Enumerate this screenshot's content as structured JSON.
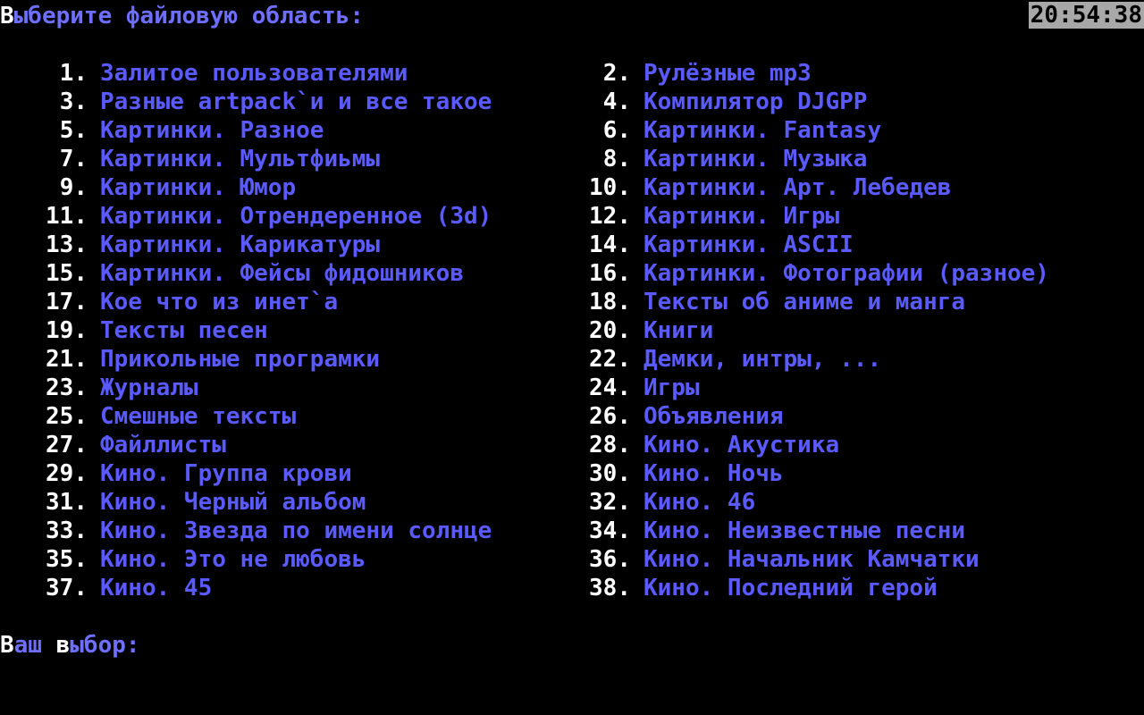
{
  "header": {
    "prompt_first_letter": "В",
    "prompt_rest": "ыберите файловую область:",
    "clock": "20:54:38"
  },
  "menu": {
    "left": [
      {
        "num": "1.",
        "label": "Залитое пользователями"
      },
      {
        "num": "3.",
        "label": "Разные artpack`и и все такое"
      },
      {
        "num": "5.",
        "label": "Картинки. Разное"
      },
      {
        "num": "7.",
        "label": "Картинки. Мультфиьмы"
      },
      {
        "num": "9.",
        "label": "Картинки. Юмор"
      },
      {
        "num": "11.",
        "label": "Картинки. Отрендеренное (3d)"
      },
      {
        "num": "13.",
        "label": "Картинки. Карикатуры"
      },
      {
        "num": "15.",
        "label": "Картинки. Фейсы фидошников"
      },
      {
        "num": "17.",
        "label": "Кое что из инет`а"
      },
      {
        "num": "19.",
        "label": "Тексты песен"
      },
      {
        "num": "21.",
        "label": "Прикольные програмки"
      },
      {
        "num": "23.",
        "label": "Журналы"
      },
      {
        "num": "25.",
        "label": "Смешные тексты"
      },
      {
        "num": "27.",
        "label": "Файллисты"
      },
      {
        "num": "29.",
        "label": "Кино. Группа крови"
      },
      {
        "num": "31.",
        "label": "Кино. Черный альбом"
      },
      {
        "num": "33.",
        "label": "Кино. Звезда по имени солнце"
      },
      {
        "num": "35.",
        "label": "Кино. Это не любовь"
      },
      {
        "num": "37.",
        "label": "Кино. 45"
      }
    ],
    "right": [
      {
        "num": "2.",
        "label": "Рулёзные mp3"
      },
      {
        "num": "4.",
        "label": "Компилятор DJGPP"
      },
      {
        "num": "6.",
        "label": "Картинки. Fantasy"
      },
      {
        "num": "8.",
        "label": "Картинки. Музыка"
      },
      {
        "num": "10.",
        "label": "Картинки. Арт. Лебедев"
      },
      {
        "num": "12.",
        "label": "Картинки. Игры"
      },
      {
        "num": "14.",
        "label": "Картинки. ASCII"
      },
      {
        "num": "16.",
        "label": "Картинки. Фотографии (разное)"
      },
      {
        "num": "18.",
        "label": "Тексты об аниме и манга"
      },
      {
        "num": "20.",
        "label": "Книги"
      },
      {
        "num": "22.",
        "label": "Демки, интры, ..."
      },
      {
        "num": "24.",
        "label": "Игры"
      },
      {
        "num": "26.",
        "label": "Объявления"
      },
      {
        "num": "28.",
        "label": "Кино. Акустика"
      },
      {
        "num": "30.",
        "label": "Кино. Ночь"
      },
      {
        "num": "32.",
        "label": "Кино. 46"
      },
      {
        "num": "34.",
        "label": "Кино. Неизвестные песни"
      },
      {
        "num": "36.",
        "label": "Кино. Начальник Камчатки"
      },
      {
        "num": "38.",
        "label": "Кино. Последний герой"
      }
    ]
  },
  "footer": {
    "choice_first_letter": "В",
    "choice_mid": "аш ",
    "choice_second_letter": "в",
    "choice_rest": "ыбор:",
    "input_value": ""
  },
  "colors": {
    "background": "#000000",
    "item_label": "#5a5aff",
    "item_number": "#ffffff",
    "prompt": "#6f6fff",
    "clock_bg": "#a8a8a8",
    "clock_fg": "#000000"
  }
}
